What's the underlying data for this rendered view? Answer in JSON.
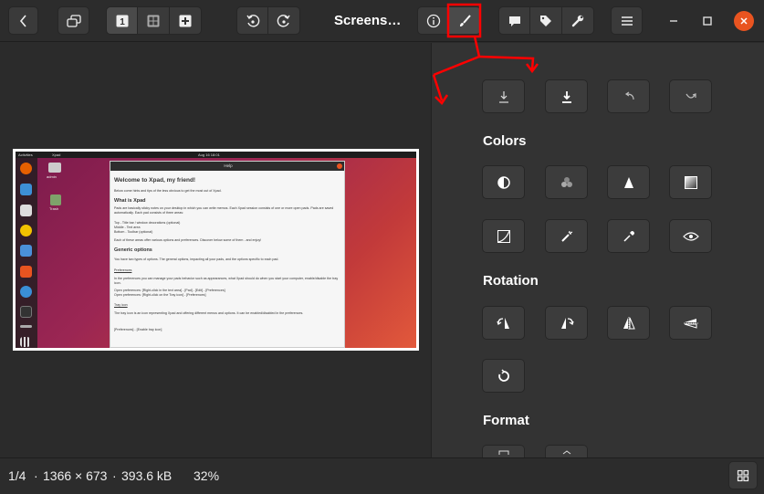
{
  "header": {
    "title": "Screens…",
    "buttons": [
      "back-icon",
      "slideshow-icon",
      "view-single-icon",
      "view-grid-icon",
      "view-add-icon",
      "rotate-left-icon",
      "rotate-right-icon",
      "info-icon",
      "edit-brush-icon",
      "comment-icon",
      "tag-icon",
      "wrench-icon",
      "menu-icon",
      "minimize-icon",
      "maximize-icon",
      "close-icon"
    ]
  },
  "panel": {
    "sections": {
      "colors": "Colors",
      "rotation": "Rotation",
      "format": "Format"
    }
  },
  "status": {
    "position": "1/4",
    "sep1": "·",
    "dimensions": "1366 × 673",
    "sep2": "·",
    "filesize": "393.6 kB",
    "zoom": "32%"
  },
  "screenshot": {
    "topbar_left": "Activities",
    "topbar_app": "Xpad",
    "topbar_clock": "Aug 16  18:01",
    "desktop_icons": [
      "admin",
      "Trash"
    ],
    "window_title": "Help",
    "heading": "Welcome to Xpad, my friend!",
    "intro": "Below come hints and tips of the less obvious to get the most out of Xpad.",
    "what_heading": "What is Xpad",
    "what_text": "Pads are basically sticky notes on your desktop in which you can write memos. Each Xpad session consists of one or more open pads. Pads are saved automatically. Each pad consists of three areas:",
    "areas": [
      "Top - Title bar / window decorations (optional)",
      "Middle - Text area",
      "Bottom - Toolbar (optional)"
    ],
    "areas_note": "Each of these areas offer various options and preferences. Discover below some of them - and enjoy!",
    "generic_heading": "Generic options",
    "generic_text": "You have two types of options. The general options, impacting all your pads, and the options specific to each pad.",
    "prefs_link": "Preferences",
    "prefs_text": "In the preferences you can manage your pads behavior such as appearances, what Xpad should do when you start your computer, enable/disable the tray icon.",
    "open_prefs_1": "Open preferences: [Right-click in the text area] - [Pad] - [Edit] - [Preferences]",
    "open_prefs_2": "Open preferences: [Right-click on the Tray icon] - [Preferences]",
    "tray_link": "Tray icon",
    "tray_text": "The tray icon is an icon representing Xpad and offering different menus and options. It can be enabled/disabled in the preferences.",
    "tray_path": "[Preferences] - [Enable tray icon]"
  },
  "colors": {
    "accent": "#e95420",
    "annotation": "#ff0000"
  }
}
